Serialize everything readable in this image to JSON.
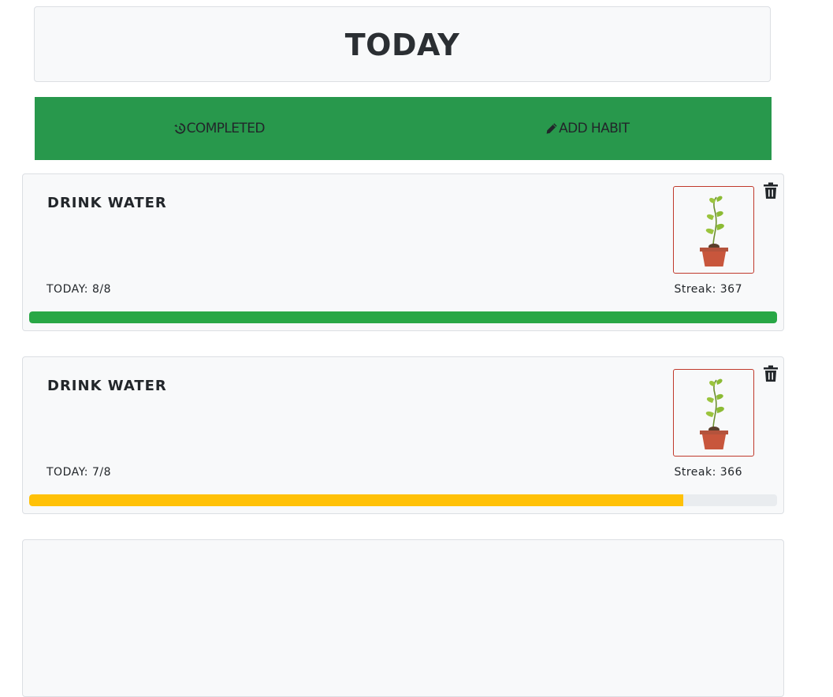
{
  "header": {
    "title": "TODAY"
  },
  "nav": {
    "completed_label": "COMPLETED",
    "completed_icon": "history-icon",
    "add_habit_label": "ADD HABIT",
    "add_habit_icon": "pencil-icon"
  },
  "colors": {
    "nav_background": "#28984c",
    "progress_complete": "#28a745",
    "progress_partial": "#ffc107",
    "plant_box_border": "#c0392b"
  },
  "habits": [
    {
      "name": "DRINK WATER",
      "today_text": "TODAY: 8/8",
      "streak_text": "Streak: 367",
      "progress": 1.0,
      "progress_color": "#28a745",
      "image_icon": "potted-plant-icon",
      "delete_icon": "trash-icon"
    },
    {
      "name": "DRINK WATER",
      "today_text": "TODAY: 7/8",
      "streak_text": "Streak: 366",
      "progress": 0.875,
      "progress_color": "#ffc107",
      "image_icon": "potted-plant-icon",
      "delete_icon": "trash-icon"
    }
  ]
}
